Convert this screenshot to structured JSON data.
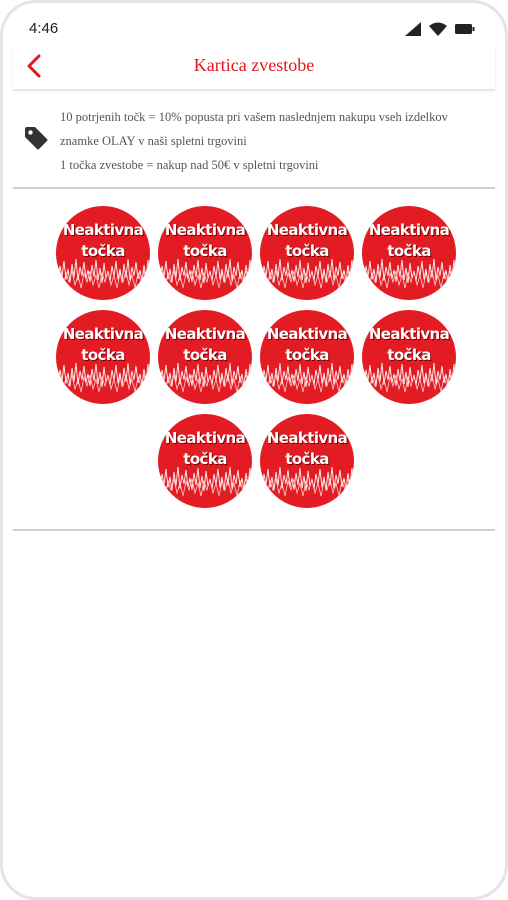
{
  "status_bar": {
    "time": "4:46"
  },
  "header": {
    "title": "Kartica zvestobe"
  },
  "info": {
    "line1": "10 potrjenih točk = 10% popusta pri vašem naslednjem nakupu vseh izdelkov znamke OLAY v naši spletni trgovini",
    "line2": "1 točka zvestobe = nakup nad 50€ v spletni trgovini"
  },
  "stamps": {
    "line1": "Neaktivna",
    "line2": "točka",
    "count": 10,
    "color": "#e31b23"
  },
  "colors": {
    "accent": "#e2181f"
  }
}
